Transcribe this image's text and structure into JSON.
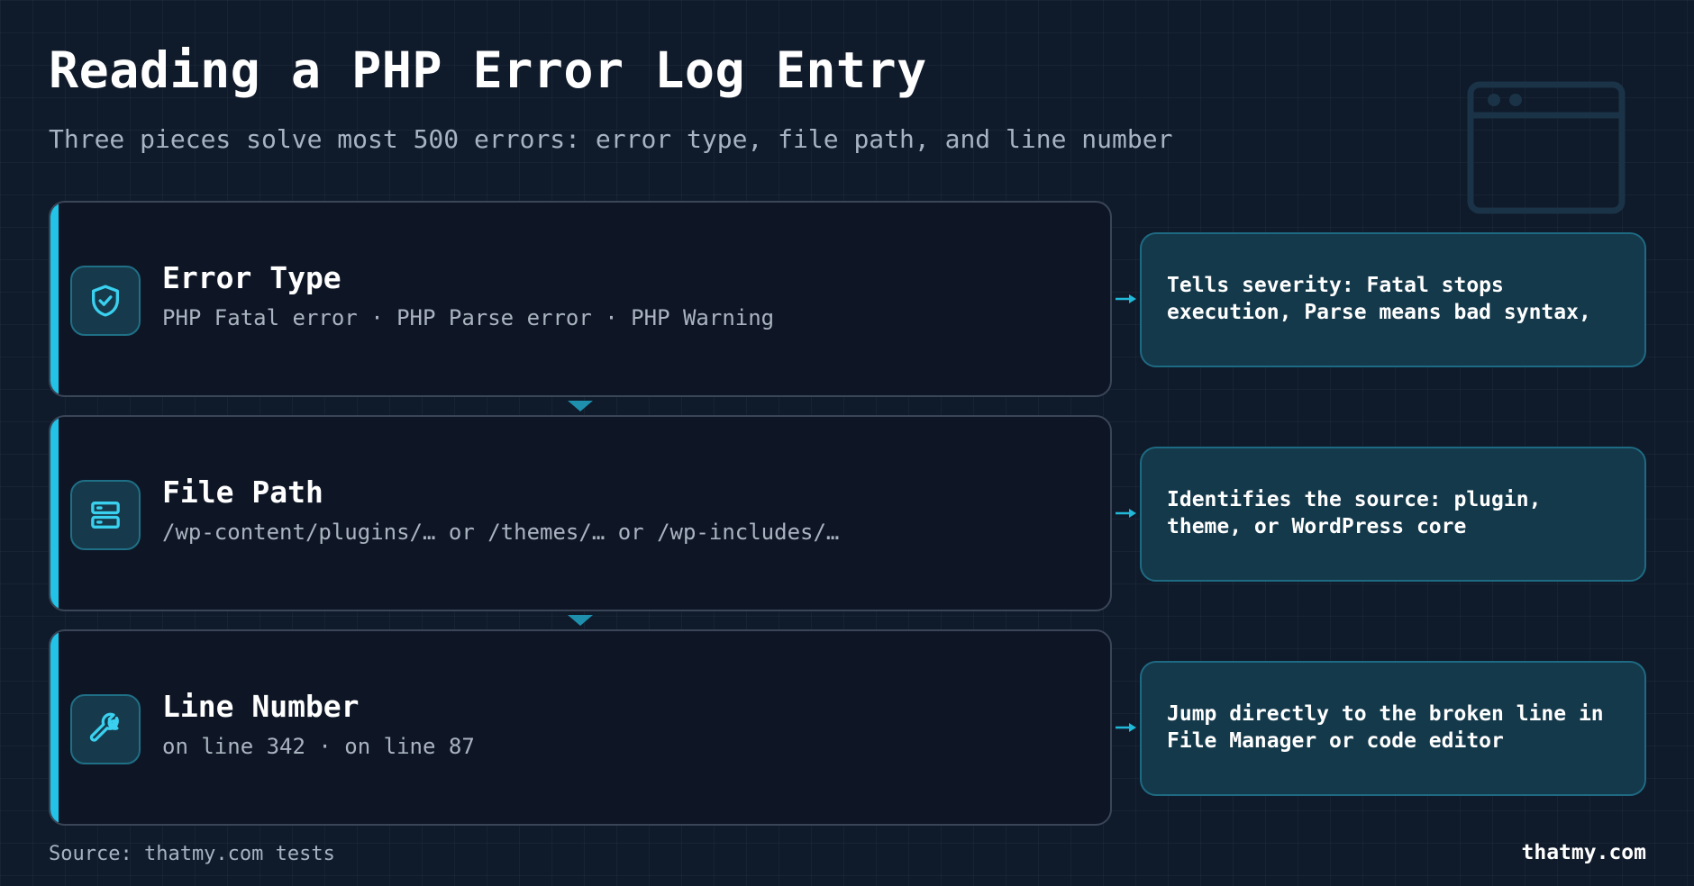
{
  "header": {
    "title": "Reading a PHP Error Log Entry",
    "subtitle": "Three pieces solve most 500 errors: error type, file path, and line number"
  },
  "steps": [
    {
      "title": "Error Type",
      "description": "PHP Fatal error · PHP Parse error · PHP Warning",
      "icon": "shield-check-icon",
      "note": "Tells severity: Fatal stops execution, Parse means bad syntax,"
    },
    {
      "title": "File Path",
      "description": "/wp-content/plugins/… or /themes/… or /wp-includes/…",
      "icon": "server-icon",
      "note": "Identifies the source: plugin, theme, or WordPress core"
    },
    {
      "title": "Line Number",
      "description": "on line 342 · on line 87",
      "icon": "wrench-icon",
      "note": "Jump directly to the broken line in File Manager or code editor"
    }
  ],
  "footer": {
    "source": "Source: thatmy.com tests",
    "brand": "thatmy.com"
  },
  "colors": {
    "accent": "#22c3e6",
    "card_bg": "#0e1626",
    "note_bg": "#14394b",
    "background": "#0f1a2a"
  }
}
